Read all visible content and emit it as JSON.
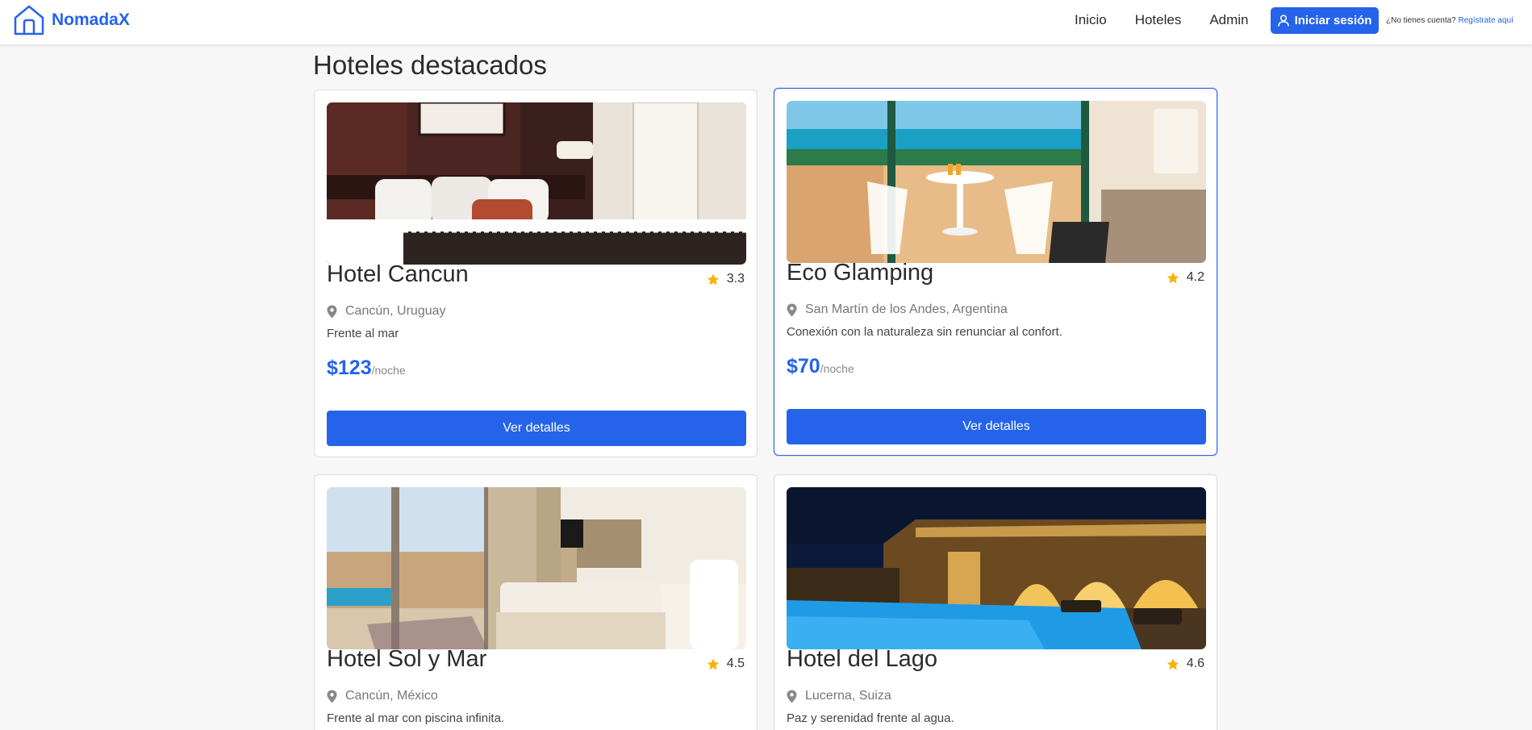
{
  "brand": {
    "name": "NomadaX",
    "icon": "house-icon",
    "color": "#2563eb"
  },
  "nav": {
    "links": [
      "Inicio",
      "Hoteles",
      "Admin"
    ],
    "login_label": "Iniciar sesión",
    "login_icon": "user-icon",
    "signup_prompt": "¿No tienes cuenta?",
    "signup_link": "Regístrate aquí"
  },
  "main": {
    "title": "Hoteles destacados",
    "hotels": [
      {
        "name": "Hotel Cancun",
        "rating": "3.3",
        "location": "Cancún, Uruguay",
        "description": "Frente al mar",
        "price": "$123",
        "price_unit": "/noche",
        "button_label": "Ver detalles",
        "image": "hotel-bedroom-photo"
      },
      {
        "name": "Eco Glamping",
        "rating": "4.2",
        "location": "San Martín de los Andes, Argentina",
        "description": "Conexión con la naturaleza sin renunciar al confort.",
        "price": "$70",
        "price_unit": "/noche",
        "button_label": "Ver detalles",
        "image": "ocean-balcony-photo"
      },
      {
        "name": "Hotel Sol y Mar",
        "rating": "4.5",
        "location": "Cancún, México",
        "description": "Frente al mar con piscina infinita.",
        "image": "desert-suite-photo"
      },
      {
        "name": "Hotel del Lago",
        "rating": "4.6",
        "location": "Lucerna, Suiza",
        "description": "Paz y serenidad frente al agua.",
        "image": "night-pool-photo"
      }
    ]
  },
  "colors": {
    "accent": "#2563eb",
    "star": "#f5b301",
    "background": "#f7f7f7"
  }
}
